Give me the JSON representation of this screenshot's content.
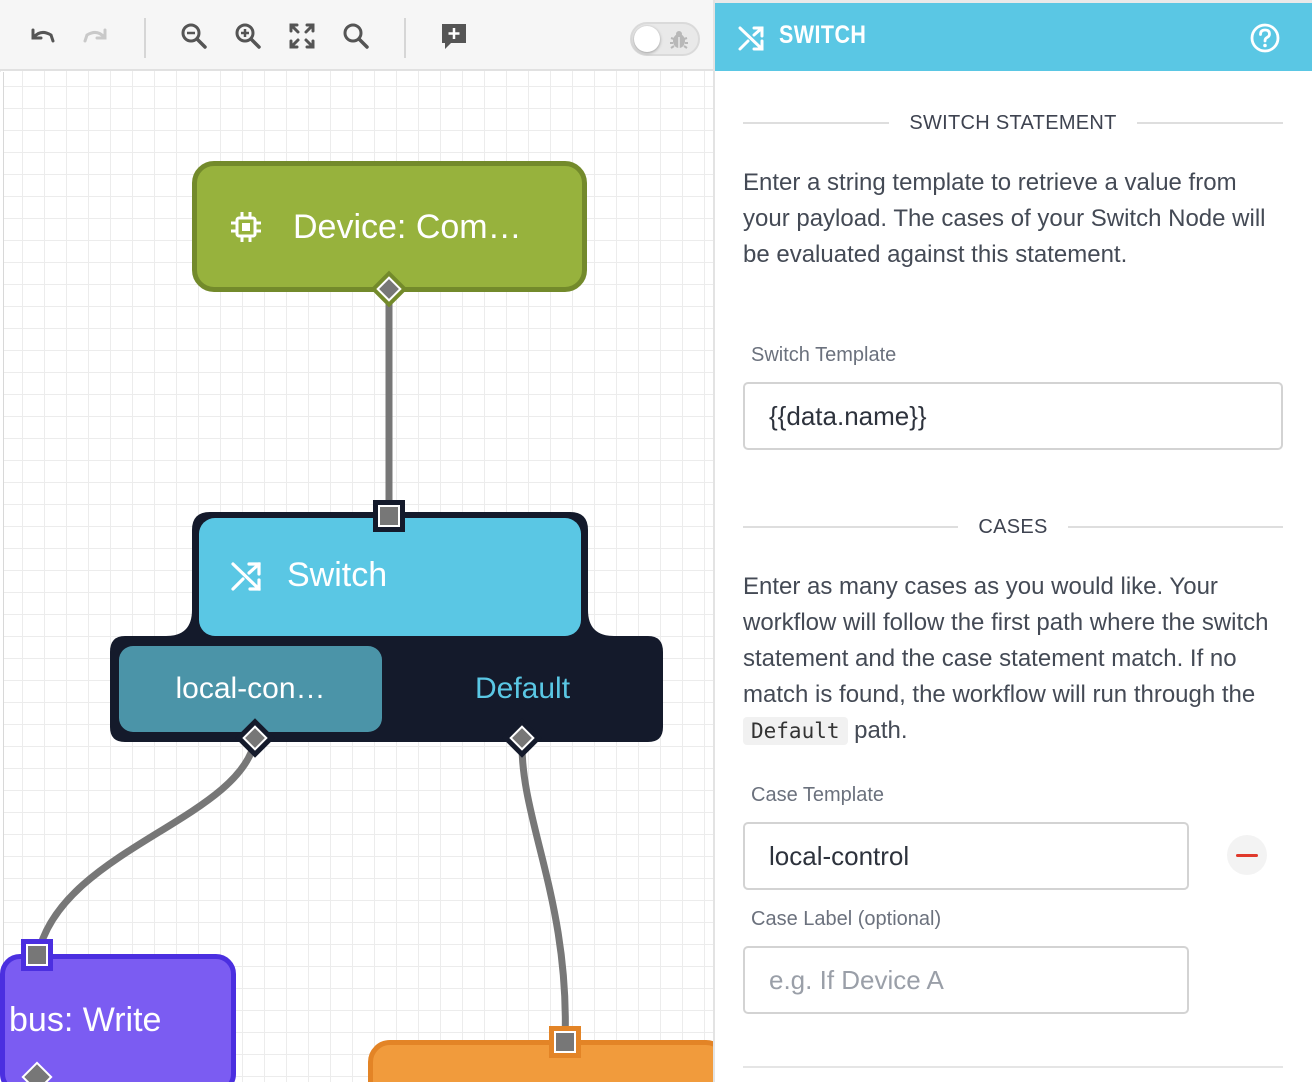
{
  "toolbar": {
    "buttons": [
      "undo-icon",
      "redo-icon",
      "zoom-out-icon",
      "zoom-in-icon",
      "fit-screen-icon",
      "search-icon",
      "add-comment-icon"
    ],
    "debug_toggle": false
  },
  "canvas": {
    "nodes": {
      "device": {
        "label": "Device: Com…",
        "icon": "device-chip-icon",
        "color": "#97b23d"
      },
      "switch": {
        "label": "Switch",
        "icon": "shuffle-icon",
        "color": "#5ac7e4"
      },
      "case_local": {
        "label": "local-con…"
      },
      "case_default": {
        "label": "Default"
      },
      "write": {
        "label": "bus: Write",
        "color": "#7b5cf2"
      },
      "orange": {
        "label": "",
        "color": "#f19b3c"
      }
    }
  },
  "panel": {
    "title": "SWITCH",
    "accent": "#5ac7e4",
    "switch_statement": {
      "heading": "SWITCH STATEMENT",
      "description": "Enter a string template to retrieve a value from your payload. The cases of your Switch Node will be evaluated against this statement.",
      "template_label": "Switch Template",
      "template_value": "{{data.name}}"
    },
    "cases": {
      "heading": "CASES",
      "description_before": "Enter as many cases as you would like. Your workflow will follow the first path where the switch statement and the case statement match. If no match is found, the workflow will run through the ",
      "description_code": "Default",
      "description_after": " path.",
      "case_template_label": "Case Template",
      "case_template_value": "local-control",
      "case_label_label": "Case Label (optional)",
      "case_label_placeholder": "e.g. If Device A"
    }
  }
}
